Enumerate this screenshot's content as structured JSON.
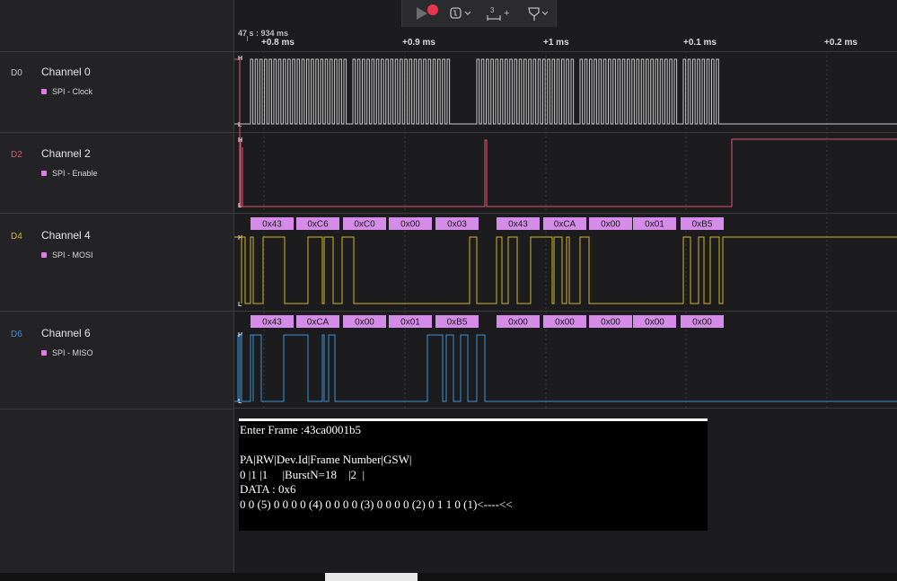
{
  "toolbar": {
    "play_icon": "play-icon",
    "record_color": "#e8364f",
    "trigger_icon": "trigger-icon",
    "measure_label": "3",
    "measure_plus": "+",
    "marker_icon": "marker-icon"
  },
  "ruler": {
    "origin": "47 s : 934 ms",
    "labels": [
      "+0.8 ms",
      "+0.9 ms",
      "+1 ms",
      "+0.1 ms",
      "+0.2 ms"
    ]
  },
  "channels": [
    {
      "id": "D0",
      "name": "Channel 0",
      "analyzer": "SPI - Clock",
      "color": "#c8c8c8"
    },
    {
      "id": "D2",
      "name": "Channel 2",
      "analyzer": "SPI - Enable",
      "color": "#e0566b"
    },
    {
      "id": "D4",
      "name": "Channel 4",
      "analyzer": "SPI - MOSI",
      "color": "#cfb62d"
    },
    {
      "id": "D6",
      "name": "Channel 6",
      "analyzer": "SPI - MISO",
      "color": "#3d8fd6"
    }
  ],
  "level_labels": {
    "high": "H",
    "low": "L"
  },
  "mosi_frames": [
    "0x43",
    "0xC6",
    "0xC0",
    "0x00",
    "0x03",
    "0x43",
    "0xCA",
    "0x00",
    "0x01",
    "0xB5"
  ],
  "miso_frames": [
    "0x43",
    "0xCA",
    "0x00",
    "0x01",
    "0xB5",
    "0x00",
    "0x00",
    "0x00",
    "0x00",
    "0x00"
  ],
  "frame_color": "#d58ce8",
  "terminal": {
    "lines": [
      "Enter Frame :43ca0001b5",
      "",
      "PA|RW|Dev.Id|Frame Number|GSW|",
      "0 |1 |1     |BurstN=18    |2  |",
      "DATA : 0x6",
      "0 0 (5) 0 0 0 0 (4) 0 0 0 0 (3) 0 0 0 0 (2) 0 1 1 0 (1)<----<<"
    ]
  }
}
